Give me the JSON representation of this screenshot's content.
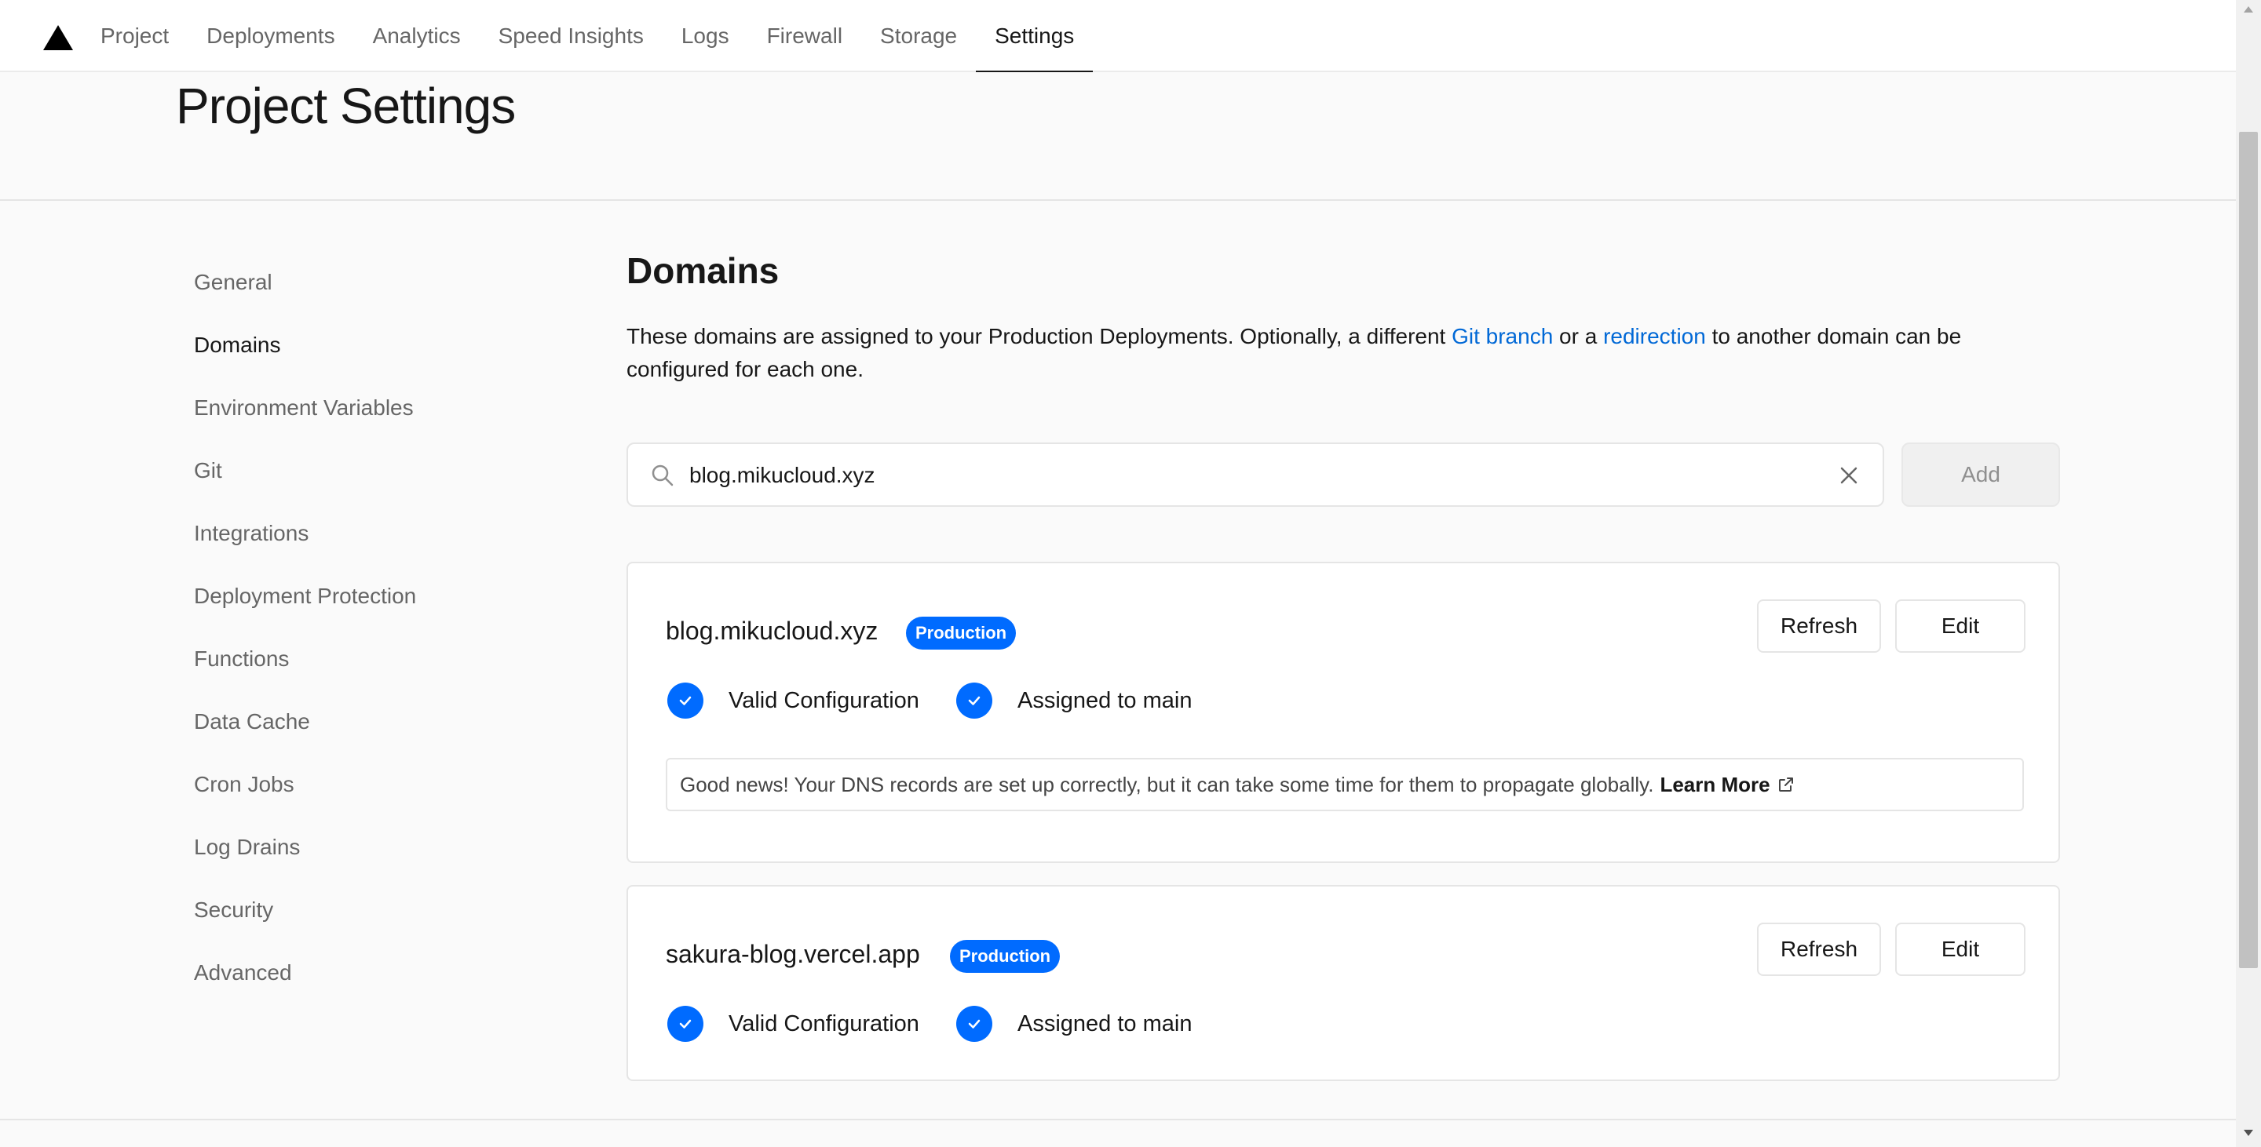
{
  "nav": {
    "tabs": [
      "Project",
      "Deployments",
      "Analytics",
      "Speed Insights",
      "Logs",
      "Firewall",
      "Storage",
      "Settings"
    ],
    "active_tab": "Settings"
  },
  "header": {
    "title": "Project Settings"
  },
  "sidebar": {
    "items": [
      {
        "label": "General"
      },
      {
        "label": "Domains"
      },
      {
        "label": "Environment Variables"
      },
      {
        "label": "Git"
      },
      {
        "label": "Integrations"
      },
      {
        "label": "Deployment Protection"
      },
      {
        "label": "Functions"
      },
      {
        "label": "Data Cache"
      },
      {
        "label": "Cron Jobs"
      },
      {
        "label": "Log Drains"
      },
      {
        "label": "Security"
      },
      {
        "label": "Advanced"
      }
    ],
    "active": "Domains"
  },
  "main": {
    "title": "Domains",
    "desc_part1": "These domains are assigned to your Production Deployments. Optionally, a different ",
    "desc_link1": "Git branch",
    "desc_part2": " or a ",
    "desc_link2": "redirection",
    "desc_part3": " to another domain can be configured for each one.",
    "search_value": "blog.mikucloud.xyz",
    "add_label": "Add",
    "domains": [
      {
        "name": "blog.mikucloud.xyz",
        "badge": "Production",
        "refresh_label": "Refresh",
        "edit_label": "Edit",
        "status1": "Valid Configuration",
        "status2": "Assigned to main",
        "notice": "Good news! Your DNS records are set up correctly, but it can take some time for them to propagate globally.",
        "learn_more": "Learn More"
      },
      {
        "name": "sakura-blog.vercel.app",
        "badge": "Production",
        "refresh_label": "Refresh",
        "edit_label": "Edit",
        "status1": "Valid Configuration",
        "status2": "Assigned to main"
      }
    ]
  },
  "colors": {
    "accent": "#006bff",
    "link": "#0068d6"
  }
}
